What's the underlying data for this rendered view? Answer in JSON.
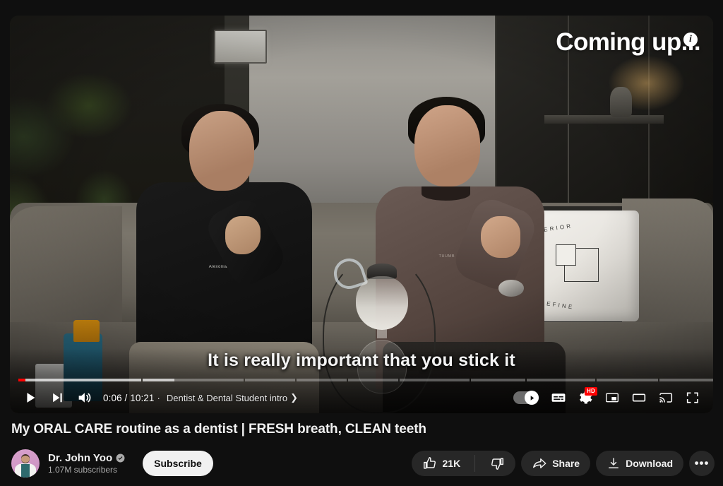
{
  "player": {
    "overlay_text": "Coming up...",
    "info_icon_label": "i",
    "caption_text": "It is really important that you stick it",
    "time_display": "0:06 / 10:21",
    "separator": "·",
    "chapter_title": "Dentist & Dental Student intro",
    "chapter_arrow": "❯",
    "quality_badge": "HD",
    "accent_color": "#ff0000",
    "controls": {
      "play_label": "Play",
      "next_label": "Next",
      "volume_label": "Mute",
      "autoplay_label": "Autoplay is on",
      "subtitles_label": "Subtitles/closed captions (c)",
      "settings_label": "Settings",
      "miniplayer_label": "Miniplayer (i)",
      "theater_label": "Theater mode (t)",
      "cast_label": "Play on TV",
      "fullscreen_label": "Full screen (f)"
    },
    "progress": {
      "played_percent": 0.97,
      "loaded_percent": 21.5,
      "chapter_widths": [
        17.1,
        14.0,
        7.0,
        7.0,
        7.0,
        9.7,
        7.6,
        9.5,
        8.6,
        8.0
      ]
    },
    "scene": {
      "pillow_line1": "ERIOR",
      "pillow_line2": "EFINE",
      "shirt_brand_left": "Alexonia",
      "shirt_brand_right": "THUMB"
    }
  },
  "video": {
    "title": "My ORAL CARE routine as a dentist | FRESH breath, CLEAN teeth"
  },
  "channel": {
    "name": "Dr. John Yoo",
    "verified": true,
    "subscribers": "1.07M subscribers",
    "subscribe_label": "Subscribe"
  },
  "actions": {
    "like_count": "21K",
    "like_label": "like",
    "dislike_label": "dislike",
    "share_label": "Share",
    "download_label": "Download",
    "more_label": "•••"
  }
}
